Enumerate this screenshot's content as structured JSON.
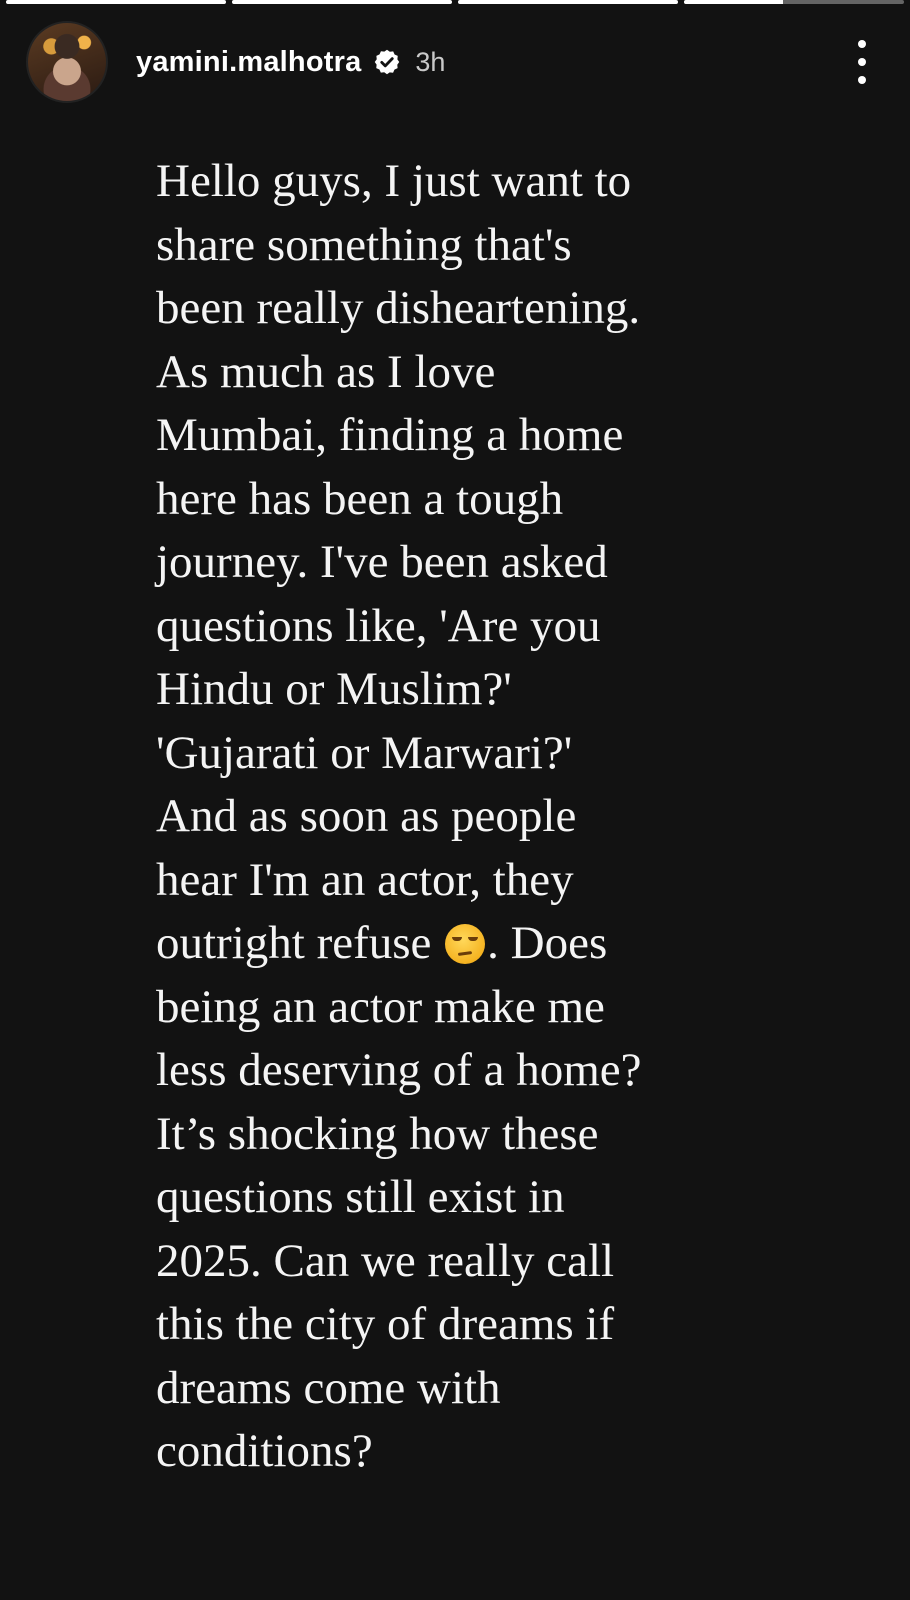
{
  "progress": [
    1.0,
    1.0,
    1.0,
    0.45
  ],
  "header": {
    "username": "yamini.malhotra",
    "time": "3h",
    "verified": true
  },
  "icons": {
    "verified": "verified-badge-icon",
    "menu": "more-vertical-icon",
    "emoji": "unamused-face-emoji"
  },
  "story": {
    "lines": [
      "Hello guys, I just want to",
      "share something that's",
      "been really disheartening.",
      "As much as I love",
      "Mumbai, finding a home",
      "here has been a tough",
      "journey. I've been asked",
      "questions like, 'Are you",
      "Hindu or Muslim?'",
      "'Gujarati or Marwari?'",
      "And as soon as people",
      "hear I'm an actor, they"
    ],
    "line_13_before_emoji": "outright refuse ",
    "line_13_after_emoji": ". Does",
    "lines_after": [
      "being an actor make me",
      "less deserving of a home?",
      "It’s shocking how these",
      "questions still exist in",
      "2025. Can we really call",
      "this the city of dreams if",
      "dreams come with",
      "conditions?"
    ]
  },
  "colors": {
    "background": "#121212",
    "text": "#f4f4f4",
    "time": "#c9c9c9"
  }
}
